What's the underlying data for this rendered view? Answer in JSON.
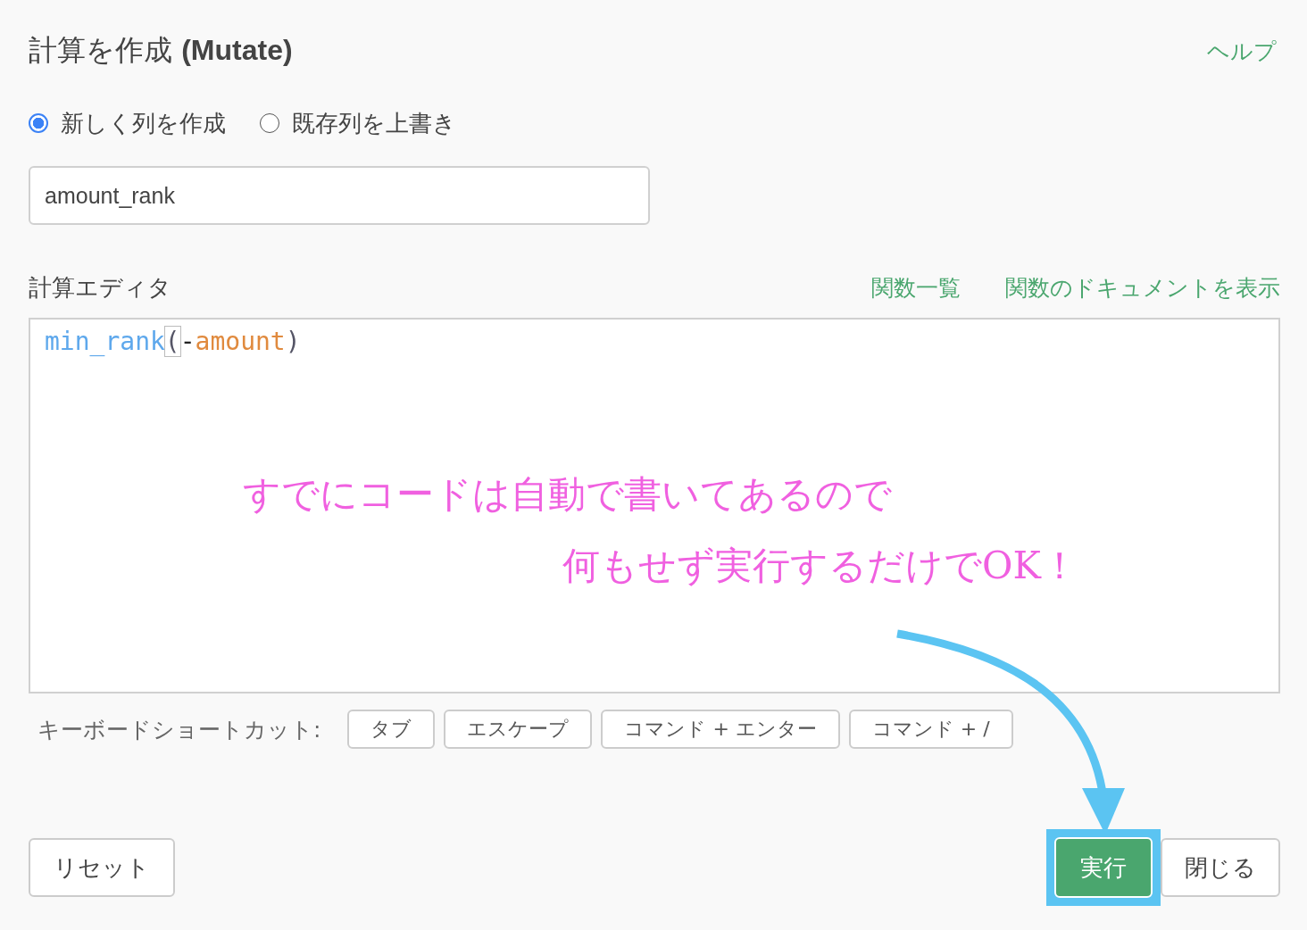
{
  "header": {
    "title": "計算を作成",
    "title_suffix": "(Mutate)",
    "help_link": "ヘルプ"
  },
  "mode_options": [
    {
      "label": "新しく列を作成",
      "selected": true
    },
    {
      "label": "既存列を上書き",
      "selected": false
    }
  ],
  "column_name": {
    "value": "amount_rank"
  },
  "editor": {
    "label": "計算エディタ",
    "links": [
      "関数一覧",
      "関数のドキュメントを表示"
    ],
    "tokens": [
      {
        "text": "min_rank",
        "kind": "function"
      },
      {
        "text": "(",
        "kind": "matched-bracket"
      },
      {
        "text": "-",
        "kind": "operator"
      },
      {
        "text": "amount",
        "kind": "variable"
      },
      {
        "text": ")",
        "kind": "bracket"
      }
    ]
  },
  "shortcuts": {
    "label": "キーボードショートカット:",
    "keys": [
      "タブ",
      "エスケープ",
      "コマンド + エンター",
      "コマンド + /"
    ]
  },
  "annotation": {
    "lines": [
      "すでにコードは自動で書いてあるので",
      "何もせず実行するだけでOK！"
    ]
  },
  "buttons": {
    "reset": "リセット",
    "run": "実行",
    "close": "閉じる",
    "run_highlighted": true
  }
}
